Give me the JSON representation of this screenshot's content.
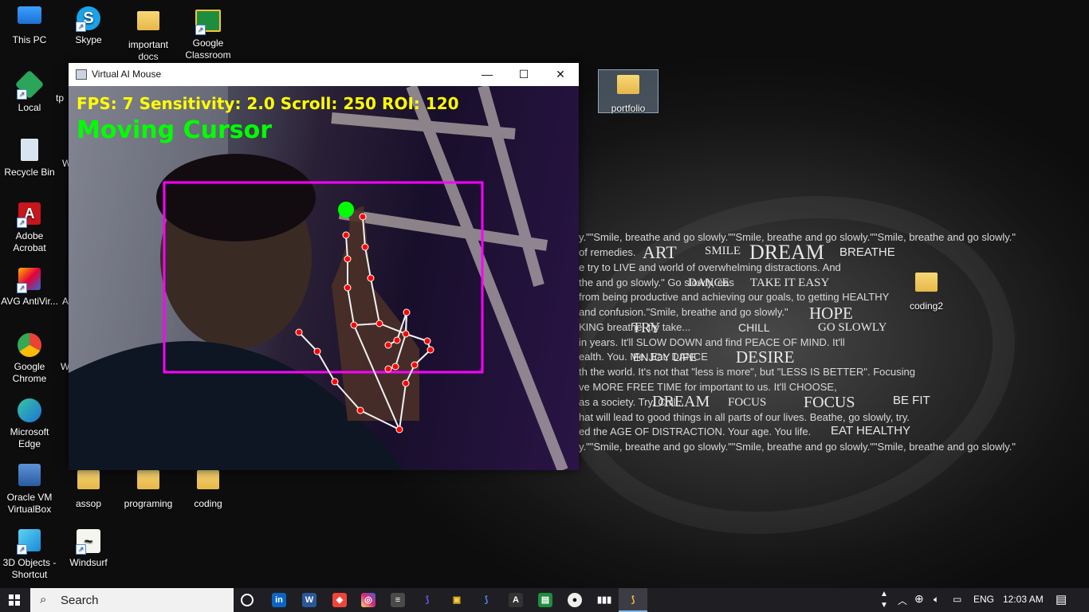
{
  "desktop": {
    "icons": [
      {
        "label": "This PC"
      },
      {
        "label": "Skype"
      },
      {
        "label": "important docs"
      },
      {
        "label": "Google Classroom"
      },
      {
        "label": "Local"
      },
      {
        "label": "Recycle Bin"
      },
      {
        "label": "Adobe Acrobat"
      },
      {
        "label": "AVG AntiVir..."
      },
      {
        "label": "Google Chrome"
      },
      {
        "label": "Microsoft Edge"
      },
      {
        "label": "Oracle VM VirtualBox"
      },
      {
        "label": "3D Objects - Shortcut"
      },
      {
        "label": "Windsurf"
      },
      {
        "label": "assop"
      },
      {
        "label": "programing"
      },
      {
        "label": "coding"
      },
      {
        "label": "portfolio"
      },
      {
        "label": "coding2"
      }
    ],
    "partial_labels": [
      "tp",
      "W",
      "A",
      "W"
    ],
    "wallpaper_lines": [
      "y.\"\"Smile, breathe and go slowly.\"\"Smile, breathe and go slowly.\"\"Smile, breathe and go slowly.\"",
      "of remedies.",
      "e try to LIVE and            world of overwhelming distractions. And",
      "the and go slowly.\"                                       Go slowly, eas",
      "              from being productive and achieving our goals, to getting HEALTHY",
      "and confusion.\"Smile, breathe and go slowly.\"",
      "KING                      breathe, try        take...",
      "              in years. It'll            SLOW DOWN and find PEACE OF MIND. It'll",
      "ealth. You.                Me.                                    Eat. DANCE",
      "th the world. It's not that \"less is more\", but \"LESS IS BETTER\". Focusing",
      "ve MORE FREE TIME for           important to us. It'll                    CHOOSE,",
      " as a society.                                  Try.                    Chill.",
      "hat will lead to good things in all parts of our lives. Beathe, go slowly, try.",
      "ed the AGE OF DISTRACTION. Your age. You life.",
      "y.\"\"Smile, breathe and go slowly.\"\"Smile, breathe and go slowly.\"\"Smile, breathe and go slowly.\""
    ],
    "wallpaper_words": [
      "ART",
      "SMILE",
      "DREAM",
      "BREATHE",
      "DANCE",
      "TAKE IT EASY",
      "HOPE",
      "TRY",
      "CHILL",
      "GO SLOWLY",
      "ENJOY LIFE",
      "DESIRE",
      "DREAM",
      "FOCUS",
      "FOCUS",
      "BE FIT",
      "EAT HEALTHY"
    ]
  },
  "window": {
    "title": "Virtual AI Mouse",
    "minimize_glyph": "—",
    "maximize_glyph": "☐",
    "close_glyph": "✕",
    "overlay_stats": "FPS: 7  Sensitivity: 2.0  Scroll: 250  ROI: 120",
    "overlay_mode": "Moving Cursor",
    "colors": {
      "stats": "#ffff00",
      "mode": "#00ff00",
      "roi": "#ff00ff",
      "landmark": "#ff0000",
      "pointer": "#00ff00"
    }
  },
  "taskbar": {
    "search_placeholder": "Search",
    "apps": [
      "task-view",
      "linkedin",
      "word",
      "anydesk",
      "instagram",
      "sublime",
      "python-idle",
      "shortcut",
      "python",
      "font-a",
      "gclassroom",
      "obs",
      "audio",
      "python-active"
    ],
    "tray": {
      "language": "ENG",
      "time": "12:03 AM"
    }
  }
}
